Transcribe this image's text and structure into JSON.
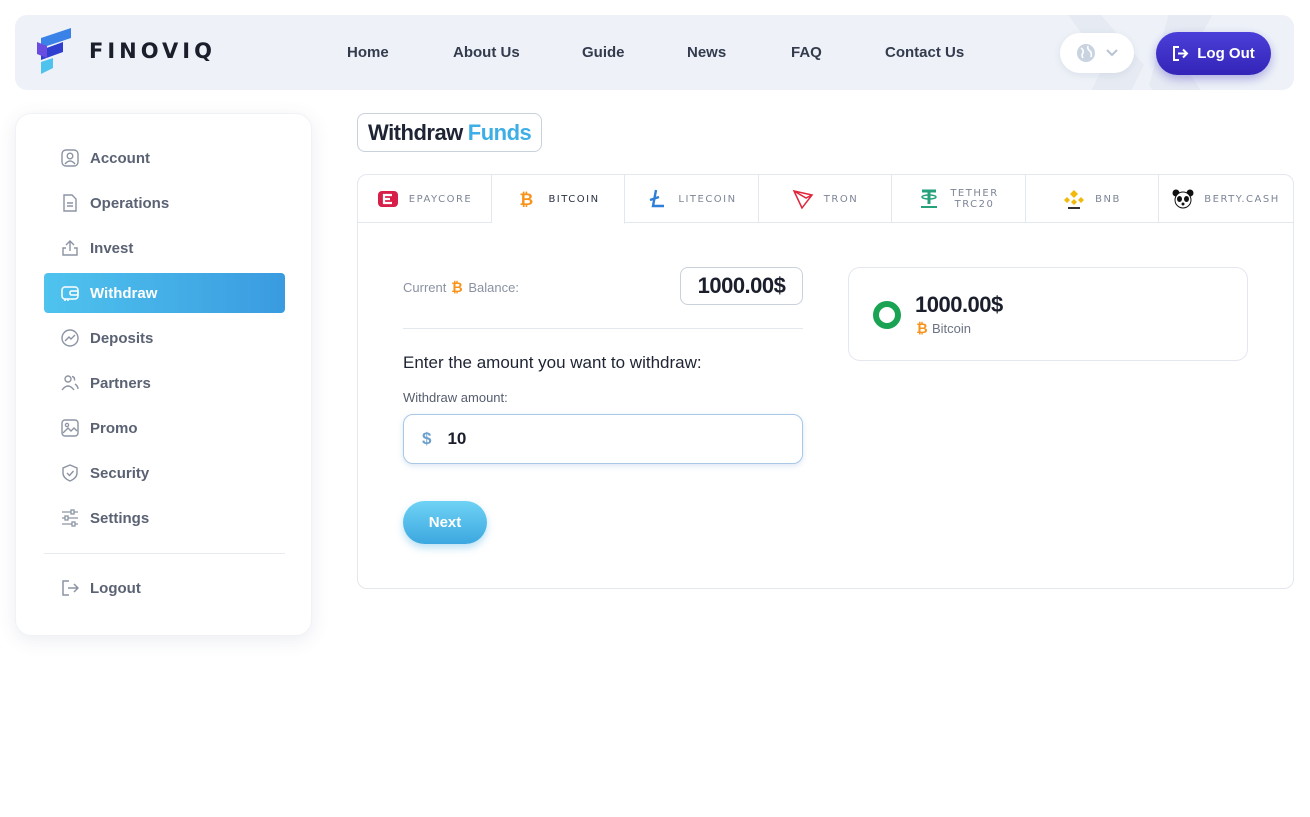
{
  "brand": {
    "name": "FINOVIQ"
  },
  "nav": [
    {
      "label": "Home"
    },
    {
      "label": "About Us"
    },
    {
      "label": "Guide"
    },
    {
      "label": "News"
    },
    {
      "label": "FAQ"
    },
    {
      "label": "Contact Us"
    }
  ],
  "header": {
    "logout_label": "Log Out",
    "language_icon": "globe-icon"
  },
  "sidebar": {
    "items": [
      {
        "label": "Account",
        "icon": "user-icon"
      },
      {
        "label": "Operations",
        "icon": "document-icon"
      },
      {
        "label": "Invest",
        "icon": "upload-icon"
      },
      {
        "label": "Withdraw",
        "icon": "wallet-icon",
        "active": true
      },
      {
        "label": "Deposits",
        "icon": "chart-icon"
      },
      {
        "label": "Partners",
        "icon": "users-icon"
      },
      {
        "label": "Promo",
        "icon": "image-icon"
      },
      {
        "label": "Security",
        "icon": "shield-icon"
      },
      {
        "label": "Settings",
        "icon": "sliders-icon"
      }
    ],
    "logout_label": "Logout"
  },
  "page": {
    "title_1": "Withdraw",
    "title_2": "Funds"
  },
  "tabs": [
    {
      "label": "EPAYCORE",
      "icon": "epaycore-icon"
    },
    {
      "label": "BITCOIN",
      "icon": "bitcoin-icon",
      "active": true
    },
    {
      "label": "LITECOIN",
      "icon": "litecoin-icon"
    },
    {
      "label": "TRON",
      "icon": "tron-icon"
    },
    {
      "label": "TETHER TRC20",
      "icon": "tether-icon"
    },
    {
      "label": "BNB",
      "icon": "bnb-icon"
    },
    {
      "label": "BERTY.CASH",
      "icon": "panda-icon"
    }
  ],
  "withdraw": {
    "balance_label_1": "Current",
    "balance_label_2": "Balance:",
    "balance_value": "1000.00$",
    "enter_title": "Enter the amount you want to withdraw:",
    "amount_label": "Withdraw amount:",
    "currency_symbol": "$",
    "amount_value": "10",
    "next_label": "Next"
  },
  "wallet": {
    "amount": "1000.00$",
    "currency": "Bitcoin"
  },
  "colors": {
    "accent": "#3eaee6",
    "primary": "#3424b8",
    "success": "#1aa352",
    "bitcoin": "#f7931a"
  }
}
